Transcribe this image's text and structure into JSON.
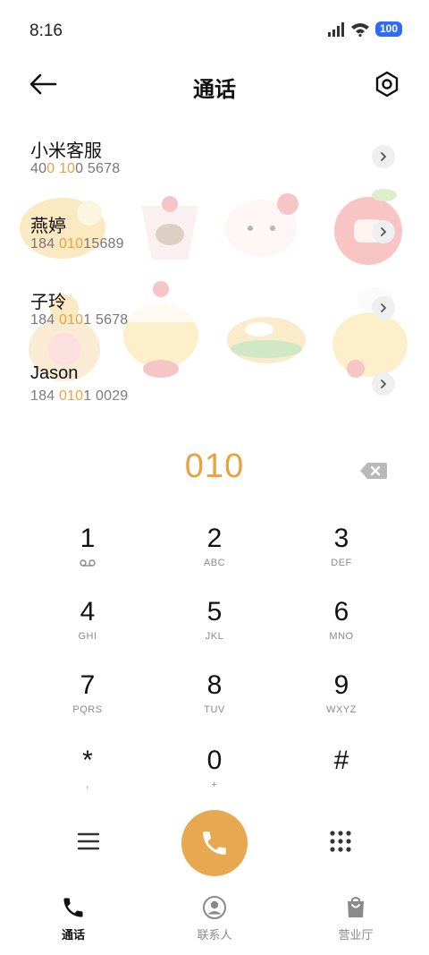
{
  "status_bar": {
    "time": "8:16",
    "battery": "100",
    "icons": [
      "signal-icon",
      "wifi-icon",
      "battery-icon"
    ]
  },
  "header": {
    "title": "通话",
    "back_icon": "arrow-left-icon",
    "settings_icon": "settings-icon"
  },
  "contacts": [
    {
      "name": "小米客服",
      "number_parts": [
        "40",
        "0 10",
        "0 5678"
      ]
    },
    {
      "name": "燕婷",
      "number_parts": [
        "184 ",
        "010",
        "15689"
      ]
    },
    {
      "name": "子玲",
      "number_parts": [
        "184 ",
        "010",
        "1 5678"
      ]
    },
    {
      "name": "Jason",
      "number_parts": [
        "184 ",
        "010",
        "1 0029"
      ]
    }
  ],
  "dialer": {
    "input": "010",
    "keys": [
      {
        "digit": "1",
        "letters": ""
      },
      {
        "digit": "2",
        "letters": "ABC"
      },
      {
        "digit": "3",
        "letters": "DEF"
      },
      {
        "digit": "4",
        "letters": "GHI"
      },
      {
        "digit": "5",
        "letters": "JKL"
      },
      {
        "digit": "6",
        "letters": "MNO"
      },
      {
        "digit": "7",
        "letters": "PQRS"
      },
      {
        "digit": "8",
        "letters": "TUV"
      },
      {
        "digit": "9",
        "letters": "WXYZ"
      },
      {
        "digit": "*",
        "letters": ","
      },
      {
        "digit": "0",
        "letters": "+"
      },
      {
        "digit": "#",
        "letters": ""
      }
    ]
  },
  "nav": [
    {
      "label": "通话",
      "icon": "phone-icon",
      "active": true
    },
    {
      "label": "联系人",
      "icon": "contacts-icon",
      "active": false
    },
    {
      "label": "营业厅",
      "icon": "store-icon",
      "active": false
    }
  ],
  "colors": {
    "accent": "#e8a23e",
    "call_button": "#e8a84f",
    "battery": "#2d6df6"
  }
}
